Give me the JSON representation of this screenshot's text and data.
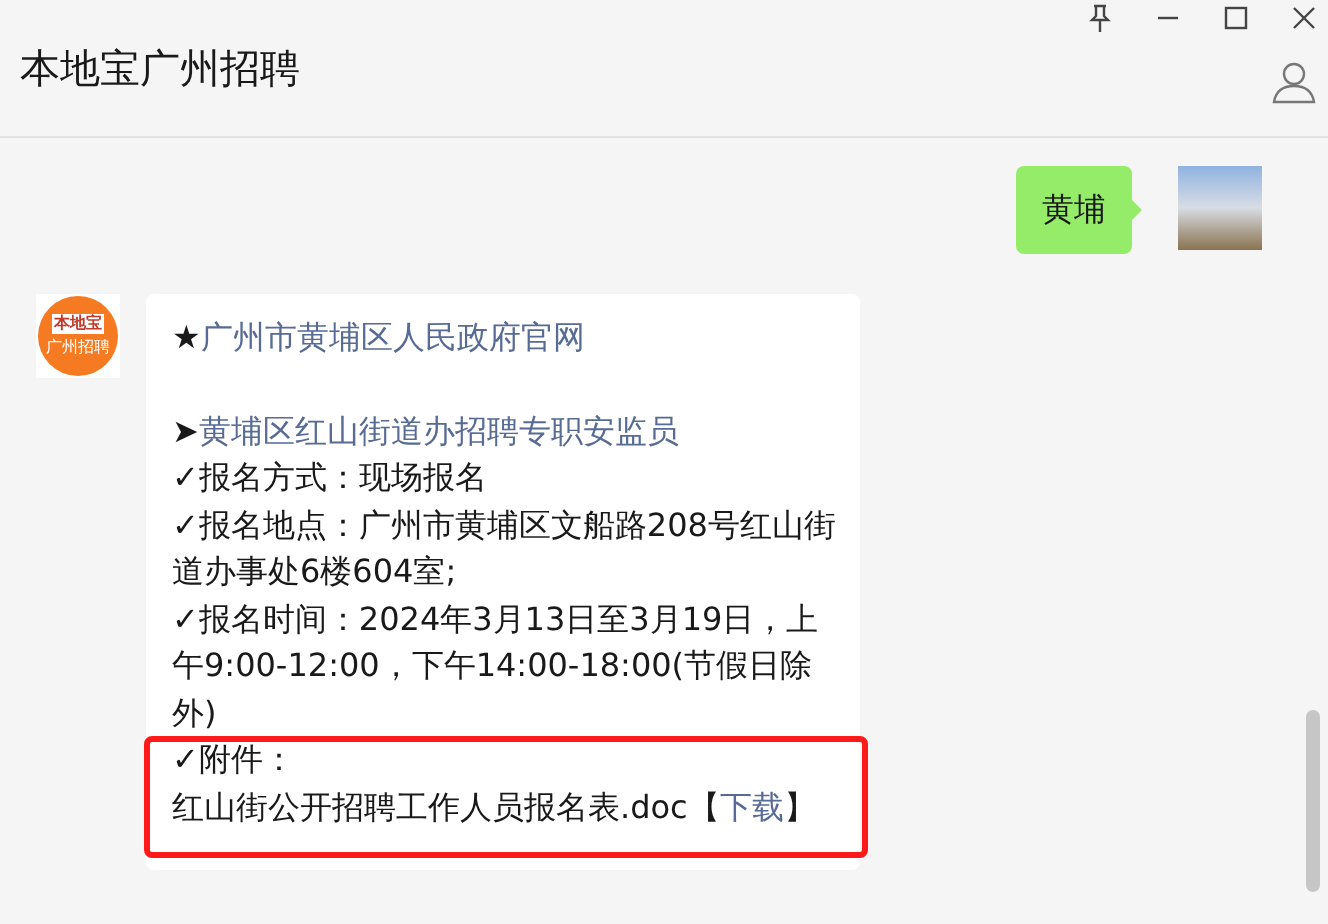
{
  "window": {
    "title": "本地宝广州招聘"
  },
  "messages": [
    {
      "kind": "sent",
      "text": "黄埔"
    },
    {
      "kind": "received",
      "logo": {
        "top": "本地宝",
        "bottom": "广州招聘"
      },
      "paragraphs": [
        {
          "gap_before": false,
          "highlighted": false,
          "segments": [
            {
              "kind": "plain",
              "text": "★"
            },
            {
              "kind": "link",
              "text": "广州市黄埔区人民政府官网"
            }
          ]
        },
        {
          "gap_before": true,
          "highlighted": false,
          "segments": [
            {
              "kind": "plain",
              "text": "➤"
            },
            {
              "kind": "link",
              "text": "黄埔区红山街道办招聘专职安监员"
            }
          ]
        },
        {
          "gap_before": false,
          "highlighted": false,
          "segments": [
            {
              "kind": "plain",
              "text": "✓报名方式：现场报名"
            }
          ]
        },
        {
          "gap_before": false,
          "highlighted": false,
          "segments": [
            {
              "kind": "plain",
              "text": "✓报名地点：广州市黄埔区文船路208号红山街道办事处6楼604室;"
            }
          ]
        },
        {
          "gap_before": false,
          "highlighted": false,
          "segments": [
            {
              "kind": "plain",
              "text": "✓报名时间：2024年3月13日至3月19日，上午9:00-12:00，下午14:00-18:00(节假日除外)"
            }
          ]
        },
        {
          "gap_before": false,
          "highlighted": true,
          "segments": [
            {
              "kind": "plain",
              "text": "✓附件："
            }
          ]
        },
        {
          "gap_before": false,
          "highlighted": true,
          "segments": [
            {
              "kind": "plain",
              "text": "红山街公开招聘工作人员报名表.doc【"
            },
            {
              "kind": "link",
              "text": "下载"
            },
            {
              "kind": "plain",
              "text": "】"
            }
          ]
        }
      ]
    }
  ]
}
